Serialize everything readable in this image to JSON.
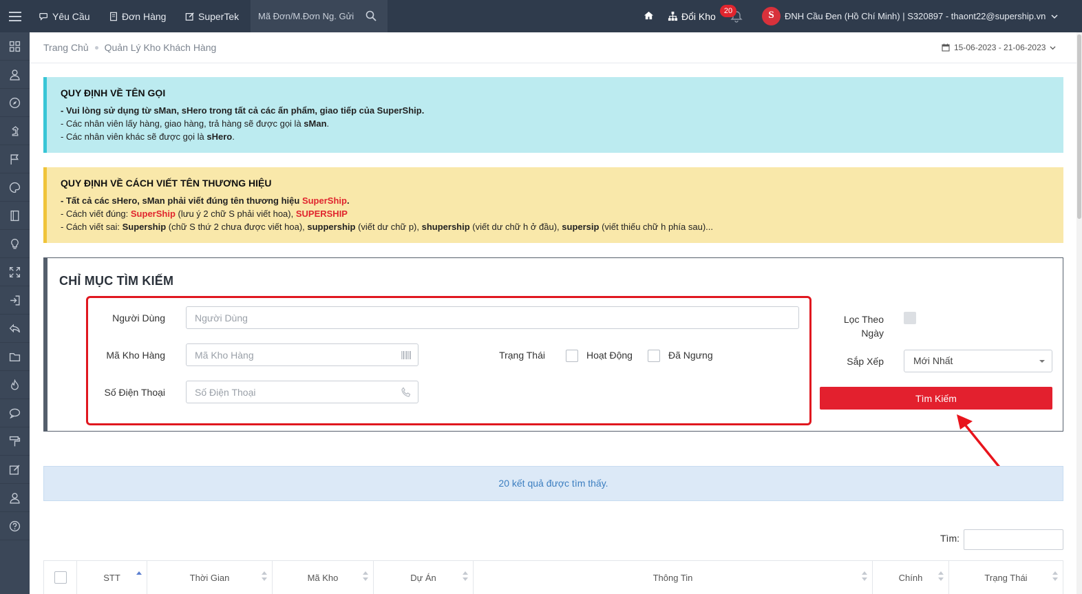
{
  "topbar": {
    "nav": [
      {
        "label": "Yêu Cầu",
        "icon": "chat-icon"
      },
      {
        "label": "Đơn Hàng",
        "icon": "document-icon"
      },
      {
        "label": "SuperTek",
        "icon": "edit-icon"
      }
    ],
    "search_placeholder": "Mã Đơn/M.Đơn Ng. Gửi",
    "doi_kho_label": "Đổi Kho",
    "notification_count": "20",
    "brand_letter": "S",
    "user_info": "ĐNH Cầu Đen (Hồ Chí Minh) | S320897 - thaont22@supership.vn"
  },
  "sidebar": {
    "icons": [
      "dashboard-icon",
      "user-icon",
      "compass-icon",
      "chess-knight-icon",
      "flag-icon",
      "palette-icon",
      "book-icon",
      "lightbulb-icon",
      "expand-icon",
      "sign-in-icon",
      "reply-icon",
      "folder-icon",
      "fire-icon",
      "comments-icon",
      "paint-roller-icon",
      "edit-icon",
      "user-icon",
      "help-icon"
    ]
  },
  "breadcrumb": {
    "home": "Trang Chủ",
    "current": "Quản Lý Kho Khách Hàng",
    "date_range": "15-06-2023 - 21-06-2023"
  },
  "alert_naming": {
    "title": "QUY ĐỊNH VỀ TÊN GỌI",
    "line1": "- Vui lòng sử dụng từ sMan, sHero trong tất cả các ấn phẩm, giao tiếp của SuperShip.",
    "line2_a": "- Các nhân viên lấy hàng, giao hàng, trả hàng sẽ được gọi là ",
    "line2_b": "sMan",
    "line2_c": ".",
    "line3_a": "- Các nhân viên khác sẽ được gọi là ",
    "line3_b": "sHero",
    "line3_c": "."
  },
  "alert_brand": {
    "title": "QUY ĐỊNH VỀ CÁCH VIẾT TÊN THƯƠNG HIỆU",
    "l1_a": "- Tất cả các sHero, sMan phải viết đúng tên thương hiệu ",
    "l1_b": "SuperShip",
    "l1_c": ".",
    "l2_a": "- Cách viết đúng: ",
    "l2_b": "SuperShip",
    "l2_c": " (lưu ý 2 chữ S phải viết hoa), ",
    "l2_d": "SUPERSHIP",
    "l3_a": "- Cách viết sai: ",
    "l3_b": "Supership",
    "l3_c": " (chữ S thứ 2 chưa được viết hoa), ",
    "l3_d": "suppership",
    "l3_e": " (viết dư chữ p), ",
    "l3_f": "shupership",
    "l3_g": " (viết dư chữ h ở đầu), ",
    "l3_h": "supersip",
    "l3_i": " (viết thiếu chữ h phía sau)..."
  },
  "search_panel": {
    "title": "CHỈ MỤC TÌM KIẾM",
    "user_label": "Người Dùng",
    "user_placeholder": "Người Dùng",
    "warehouse_label": "Mã Kho Hàng",
    "warehouse_placeholder": "Mã Kho Hàng",
    "phone_label": "Số Điện Thoại",
    "phone_placeholder": "Số Điện Thoại",
    "status_label": "Trạng Thái",
    "status_active": "Hoạt Động",
    "status_stopped": "Đã Ngưng",
    "filter_date_label_1": "Lọc Theo",
    "filter_date_label_2": "Ngày",
    "sort_label": "Sắp Xếp",
    "sort_value": "Mới Nhất",
    "search_button": "Tìm Kiếm"
  },
  "results": {
    "message": "20 kết quả được tìm thấy.",
    "filter_label": "Tìm:"
  },
  "table": {
    "columns": [
      "STT",
      "Thời Gian",
      "Mã Kho",
      "Dự Án",
      "Thông Tin",
      "Chính",
      "Trạng Thái"
    ]
  },
  "colors": {
    "topbar": "#2f3b4c",
    "accent_red": "#e3202e",
    "info_bg": "#bcebf0",
    "warn_bg": "#f9e8aa"
  }
}
